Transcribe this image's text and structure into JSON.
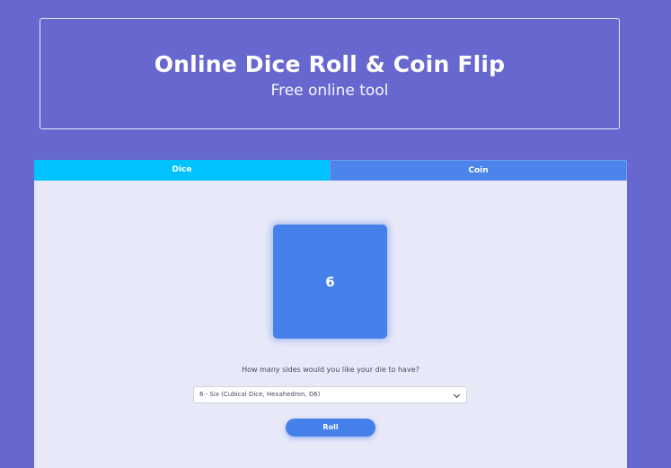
{
  "header": {
    "title": "Online Dice Roll & Coin Flip",
    "subtitle": "Free online tool"
  },
  "tabs": [
    {
      "label": "Dice",
      "active": true
    },
    {
      "label": "Coin",
      "active": false
    }
  ],
  "dice": {
    "result": "6",
    "sides_question": "How many sides would you like your die to have?",
    "sides_selected": "6 - Six (Cubical Dice, Hexahedron, D6)",
    "roll_label": "Roll"
  },
  "colors": {
    "background": "#6668cf",
    "active_tab": "#00c2ff",
    "accent": "#4680ea",
    "panel": "#e8e9f8"
  }
}
